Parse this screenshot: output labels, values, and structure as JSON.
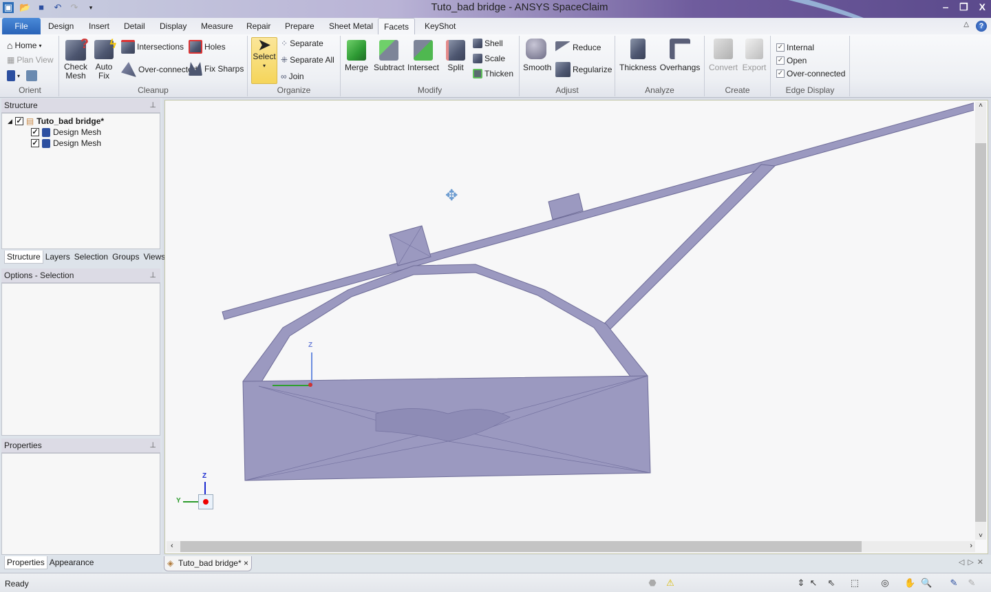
{
  "titlebar": {
    "title": "Tuto_bad bridge - ANSYS SpaceClaim",
    "minimize": "‒",
    "restore": "❐",
    "close": "X"
  },
  "qat": {
    "icons": [
      "app-icon",
      "open-icon",
      "save-icon",
      "undo-icon",
      "redo-icon",
      "customize-icon"
    ]
  },
  "tabs": [
    "File",
    "Design",
    "Insert",
    "Detail",
    "Display",
    "Measure",
    "Repair",
    "Prepare",
    "Sheet Metal",
    "Facets",
    "KeyShot"
  ],
  "active_tab": "Facets",
  "ribbon": {
    "orient": {
      "label": "Orient",
      "home": "Home",
      "plan_view": "Plan View"
    },
    "cleanup": {
      "label": "Cleanup",
      "check_mesh": "Check Mesh",
      "auto_fix": "Auto Fix",
      "intersections": "Intersections",
      "over_connected": "Over-connected",
      "holes": "Holes",
      "fix_sharps": "Fix Sharps"
    },
    "organize": {
      "label": "Organize",
      "select": "Select",
      "separate": "Separate",
      "separate_all": "Separate All",
      "join": "Join"
    },
    "modify": {
      "label": "Modify",
      "merge": "Merge",
      "subtract": "Subtract",
      "intersect": "Intersect",
      "split": "Split",
      "shell": "Shell",
      "scale": "Scale",
      "thicken": "Thicken"
    },
    "adjust": {
      "label": "Adjust",
      "smooth": "Smooth",
      "reduce": "Reduce",
      "regularize": "Regularize"
    },
    "analyze": {
      "label": "Analyze",
      "thickness": "Thickness",
      "overhangs": "Overhangs"
    },
    "create": {
      "label": "Create",
      "convert": "Convert",
      "export": "Export"
    },
    "edge_display": {
      "label": "Edge Display",
      "internal": {
        "label": "Internal",
        "checked": true
      },
      "open": {
        "label": "Open",
        "checked": true
      },
      "over_connected": {
        "label": "Over-connected",
        "checked": true
      }
    }
  },
  "structure": {
    "title": "Structure",
    "root": {
      "label": "Tuto_bad bridge*",
      "checked": true
    },
    "children": [
      {
        "label": "Design Mesh",
        "checked": true
      },
      {
        "label": "Design Mesh",
        "checked": true
      }
    ],
    "tabs": [
      "Structure",
      "Layers",
      "Selection",
      "Groups",
      "Views"
    ],
    "active_tab": "Structure"
  },
  "options": {
    "title": "Options - Selection"
  },
  "properties": {
    "title": "Properties",
    "tabs": [
      "Properties",
      "Appearance"
    ],
    "active_tab": "Properties"
  },
  "viewport": {
    "axis_z": "Z",
    "axis_y": "Y",
    "mesh_color": "#9b99c0"
  },
  "document_tab": {
    "label": "Tuto_bad bridge*",
    "close": "×"
  },
  "status": {
    "text": "Ready"
  }
}
